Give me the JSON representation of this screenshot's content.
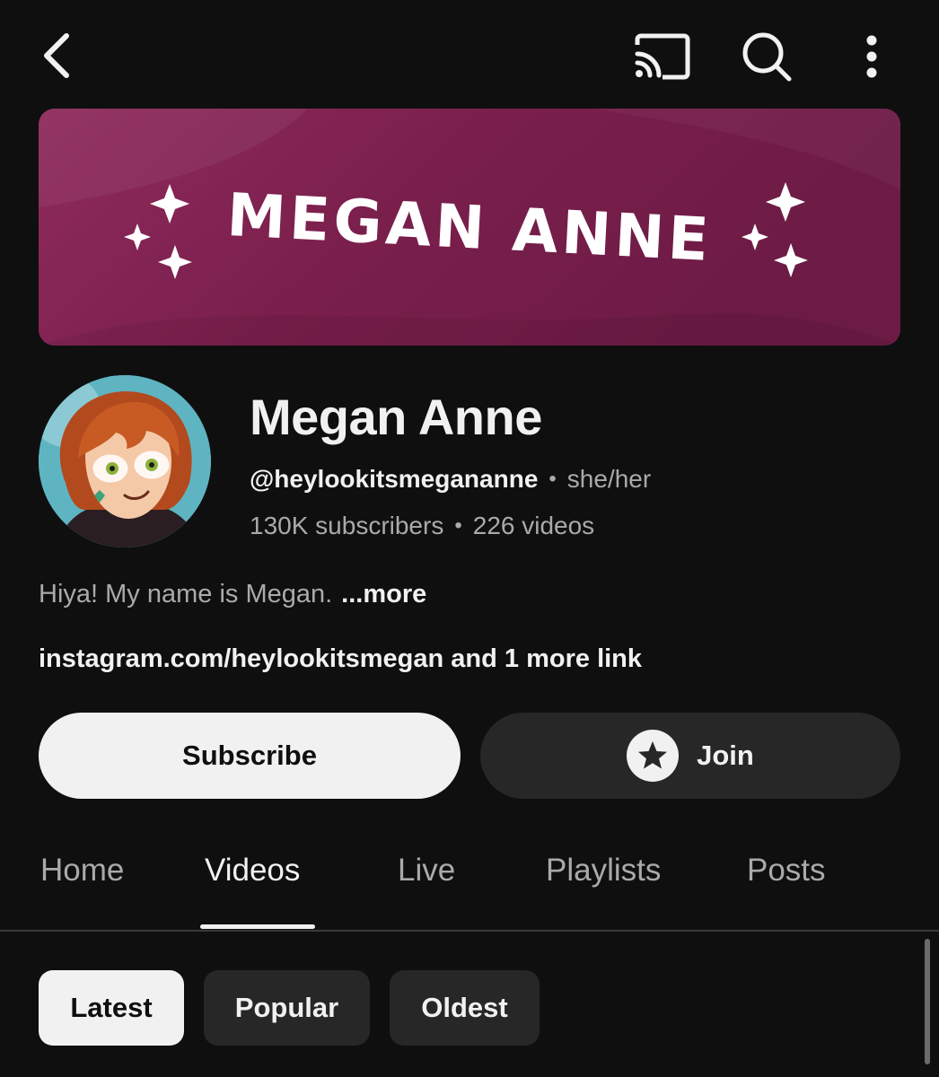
{
  "banner": {
    "title": "MEGAN ANNE",
    "colors": {
      "primary": "#8c2a5b",
      "secondary": "#6e1c46"
    }
  },
  "channel": {
    "name": "Megan Anne",
    "handle": "@heylookitsmegananne",
    "separator": "•",
    "pronouns": "she/her",
    "subscribers": "130K subscribers",
    "videos": "226 videos"
  },
  "description": {
    "text": "Hiya! My name is Megan.",
    "more_label": "...more"
  },
  "links": {
    "text": "instagram.com/heylookitsmegan and 1 more link"
  },
  "actions": {
    "subscribe_label": "Subscribe",
    "join_label": "Join"
  },
  "tabs": [
    {
      "label": "Home"
    },
    {
      "label": "Videos",
      "active": true
    },
    {
      "label": "Live"
    },
    {
      "label": "Playlists"
    },
    {
      "label": "Posts"
    }
  ],
  "filters": [
    {
      "label": "Latest",
      "active": true
    },
    {
      "label": "Popular"
    },
    {
      "label": "Oldest"
    }
  ],
  "icons": {
    "back": "chevron-left-icon",
    "cast": "cast-icon",
    "search": "search-icon",
    "more": "more-vertical-icon",
    "join": "star-icon"
  }
}
